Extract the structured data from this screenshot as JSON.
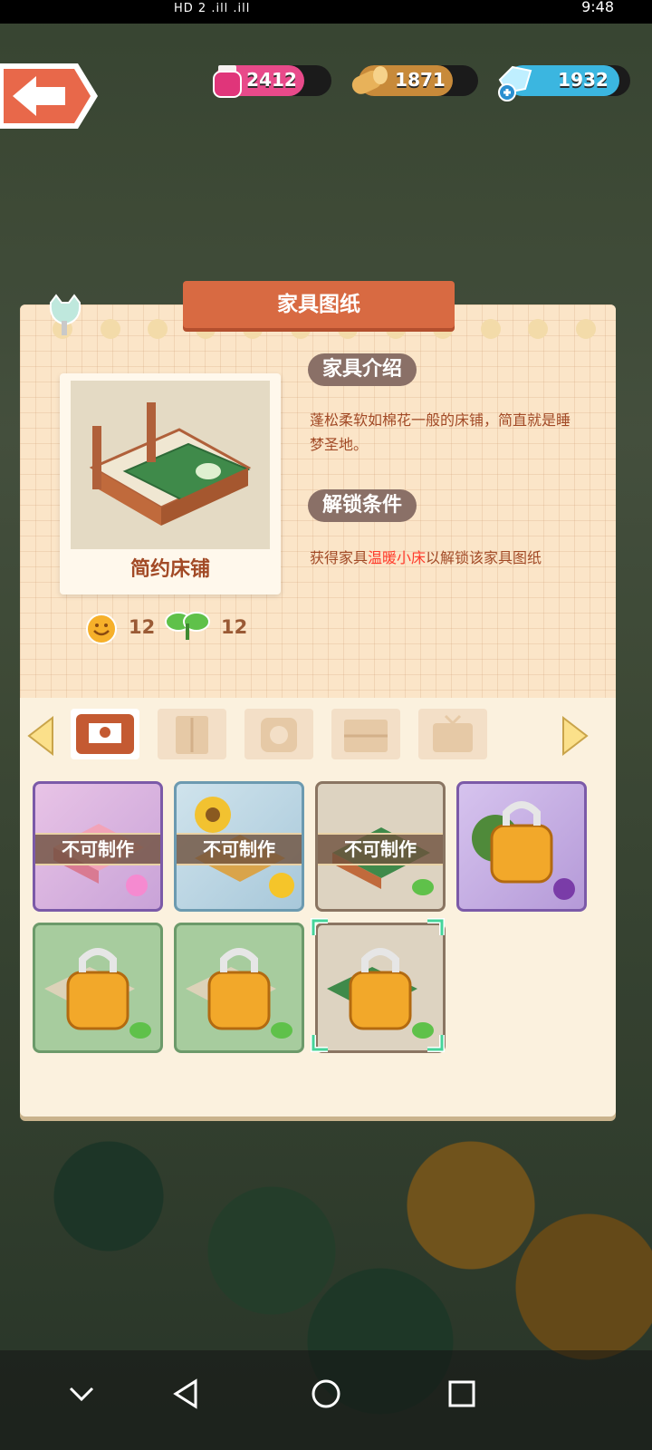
{
  "status_bar": {
    "left_text": "HD 2 .ill .ill",
    "right_text": "9:48"
  },
  "currencies": [
    {
      "name": "ink",
      "value": "2412",
      "color": "#e84a8a"
    },
    {
      "name": "wood",
      "value": "1871",
      "color": "#c88a3a"
    },
    {
      "name": "diamond",
      "value": "1932",
      "color": "#3bb6e0"
    }
  ],
  "panel": {
    "title": "家具图纸",
    "item_name": "简约床铺",
    "stat_comfort": "12",
    "stat_sprout": "12",
    "section_intro_title": "家具介绍",
    "section_intro_text": "蓬松柔软如棉花一般的床铺，简直就是睡梦圣地。",
    "section_unlock_title": "解锁条件",
    "unlock_prefix": "获得家具",
    "unlock_item": "温暖小床",
    "unlock_suffix": "以解锁该家具图纸"
  },
  "tabs": [
    {
      "icon": "bed-category-icon",
      "active": true
    },
    {
      "icon": "wardrobe-category-icon",
      "active": false
    },
    {
      "icon": "mirror-category-icon",
      "active": false
    },
    {
      "icon": "cabinet-category-icon",
      "active": false
    },
    {
      "icon": "tv-category-icon",
      "active": false
    }
  ],
  "items": [
    {
      "status": "不可制作",
      "theme": "pink-flower-bed",
      "frame": "#7b5aa8",
      "badge": "bow-icon"
    },
    {
      "status": "不可制作",
      "theme": "sunflower-bed",
      "frame": "#6c9ab0",
      "badge": "sun-icon"
    },
    {
      "status": "不可制作",
      "theme": "simple-bed",
      "frame": "#8a7562",
      "badge": "sprout-icon"
    },
    {
      "status": "",
      "theme": "vine-bed-locked",
      "frame": "#7b5aa8",
      "badge": "squid-icon"
    },
    {
      "status": "",
      "theme": "green-bed-locked",
      "frame": "#6c9a6a",
      "badge": "sprout-icon"
    },
    {
      "status": "",
      "theme": "green-bed-locked",
      "frame": "#6c9a6a",
      "badge": "sprout-icon"
    },
    {
      "status": "",
      "theme": "simple-bed-locked",
      "frame": "#8a7562",
      "badge": "sprout-icon",
      "selected": true
    }
  ]
}
